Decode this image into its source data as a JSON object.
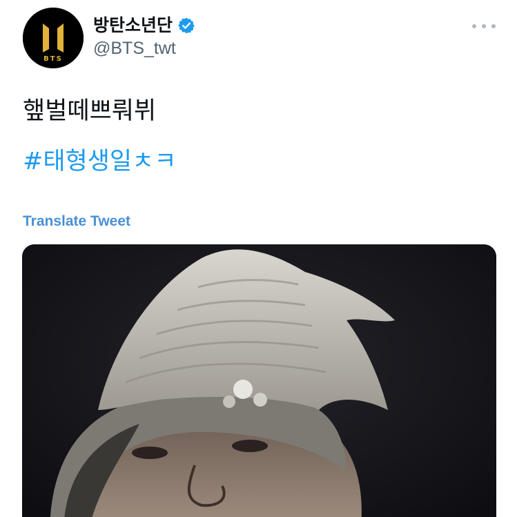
{
  "tweet": {
    "display_name": "방탄소년단",
    "handle": "@BTS_twt",
    "text": "햎벌떼쁘뤄뷔",
    "hashtag": "#태형생일ㅊㅋ",
    "translate_label": "Translate Tweet"
  },
  "avatar": {
    "logo_text": "BTS",
    "logo_color": "#e2b33a",
    "background": "#000000"
  },
  "icons": {
    "verified": "verified-badge-icon",
    "more": "more-options-icon"
  },
  "colors": {
    "link": "#1d9bf0",
    "translate": "#4a90d4",
    "handle": "#536471",
    "verified": "#1d9bf0"
  }
}
